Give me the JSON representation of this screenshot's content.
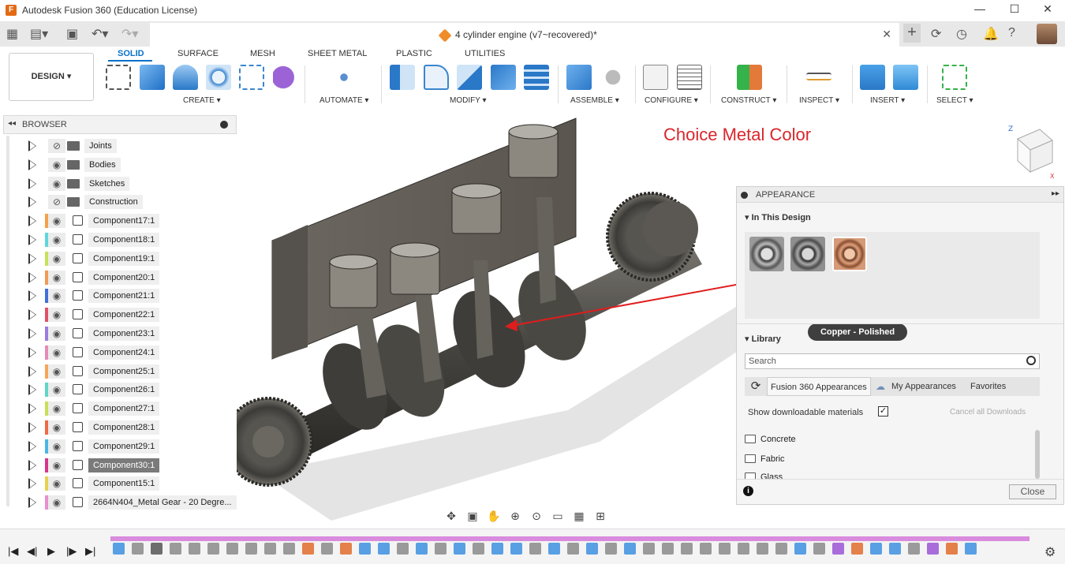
{
  "window": {
    "title": "Autodesk Fusion 360 (Education License)",
    "logo": "F",
    "minimize": "—",
    "maximize": "☐",
    "close": "✕"
  },
  "tabbar": {
    "doc_title": "4 cylinder engine (v7~recovered)*",
    "doc_close": "✕",
    "icons": [
      "apps-grid-icon",
      "file-icon",
      "save-icon",
      "undo-icon",
      "redo-icon",
      "new-tab-icon",
      "sync-icon",
      "clock-icon",
      "bell-icon",
      "help-icon"
    ]
  },
  "ribbon": {
    "workspace": "DESIGN ▾",
    "tabs": [
      "SOLID",
      "SURFACE",
      "MESH",
      "SHEET METAL",
      "PLASTIC",
      "UTILITIES"
    ],
    "active_tab": "SOLID",
    "groups": [
      "CREATE ▾",
      "AUTOMATE ▾",
      "MODIFY ▾",
      "ASSEMBLE ▾",
      "CONFIGURE ▾",
      "CONSTRUCT ▾",
      "INSPECT ▾",
      "INSERT ▾",
      "SELECT ▾"
    ]
  },
  "browser": {
    "title": "BROWSER",
    "collapse": "◂◂",
    "items": [
      {
        "label": "Joints",
        "type": "folder",
        "color": "",
        "hidden": true
      },
      {
        "label": "Bodies",
        "type": "folder",
        "color": "",
        "hidden": false
      },
      {
        "label": "Sketches",
        "type": "folder",
        "color": "",
        "hidden": false
      },
      {
        "label": "Construction",
        "type": "folder",
        "color": "",
        "hidden": true
      },
      {
        "label": "Component17:1",
        "type": "component",
        "color": "#f5a04a"
      },
      {
        "label": "Component18:1",
        "type": "component",
        "color": "#5fd6de"
      },
      {
        "label": "Component19:1",
        "type": "component",
        "color": "#c6e25a"
      },
      {
        "label": "Component20:1",
        "type": "component",
        "color": "#f29a53"
      },
      {
        "label": "Component21:1",
        "type": "component",
        "color": "#3f6fd9"
      },
      {
        "label": "Component22:1",
        "type": "component",
        "color": "#e2516a"
      },
      {
        "label": "Component23:1",
        "type": "component",
        "color": "#9b7be0"
      },
      {
        "label": "Component24:1",
        "type": "component",
        "color": "#e58bb8"
      },
      {
        "label": "Component25:1",
        "type": "component",
        "color": "#f6a65a"
      },
      {
        "label": "Component26:1",
        "type": "component",
        "color": "#5fd6c6"
      },
      {
        "label": "Component27:1",
        "type": "component",
        "color": "#c9df55"
      },
      {
        "label": "Component28:1",
        "type": "component",
        "color": "#ef6a44"
      },
      {
        "label": "Component29:1",
        "type": "component",
        "color": "#48b6e6"
      },
      {
        "label": "Component30:1",
        "type": "component",
        "color": "#d6368c",
        "selected": true
      },
      {
        "label": "Component15:1",
        "type": "component",
        "color": "#e6d14f"
      },
      {
        "label": "2664N404_Metal Gear - 20 Degre...",
        "type": "component",
        "color": "#e88fcf"
      }
    ]
  },
  "viewport": {
    "annotation": "Choice Metal Color"
  },
  "appearance": {
    "title": "APPEARANCE",
    "expand": "▸▸",
    "in_design": "In This Design",
    "swatch_tooltip": "Copper - Polished",
    "library": "Library",
    "search_placeholder": "Search",
    "lib_tabs": [
      "Fusion 360 Appearances",
      "My Appearances",
      "Favorites"
    ],
    "show_downloadable": "Show downloadable materials",
    "show_downloadable_checked": "✓",
    "cancel_downloads": "Cancel all Downloads",
    "folders": [
      "Concrete",
      "Fabric",
      "Glass"
    ],
    "close": "Close",
    "info": "i"
  },
  "timeline": {
    "controls": [
      "|◀",
      "◀|",
      "▶",
      "|▶",
      "▶|"
    ],
    "settings": "⚙"
  }
}
